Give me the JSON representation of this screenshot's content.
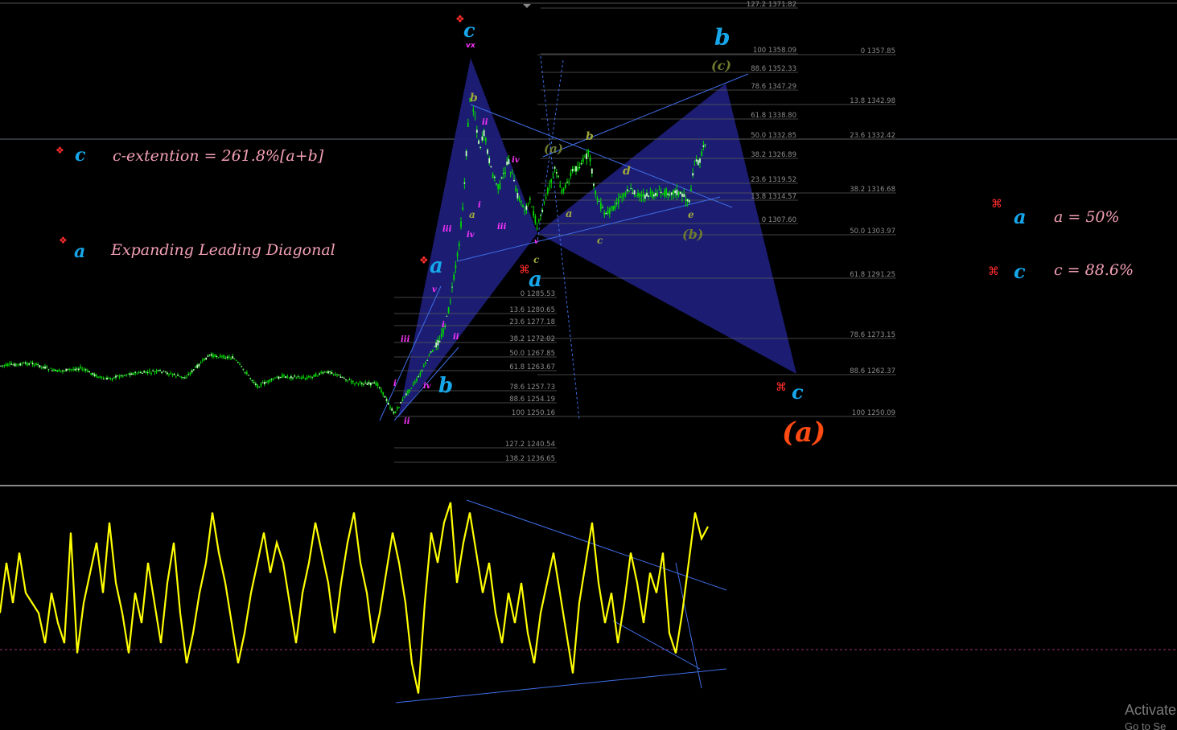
{
  "chart_data": [
    {
      "type": "line",
      "panel": "price",
      "description_from_image": "candlestick price chart with Fibonacci retracements and harmonic pattern",
      "fib_set_right": [
        {
          "label": "0 1357.85"
        },
        {
          "label": "13.8 1342.98"
        },
        {
          "label": "23.6 1332.42"
        },
        {
          "label": "38.2 1316.68"
        },
        {
          "label": "50.0 1303.97"
        },
        {
          "label": "61.8 1291.25"
        },
        {
          "label": "78.6 1273.15"
        },
        {
          "label": "88.6 1262.37"
        },
        {
          "label": "100 1250.09"
        }
      ],
      "fib_set_mid": [
        {
          "label": "127.2 1371.82"
        },
        {
          "label": "100 1358.09"
        },
        {
          "label": "88.6 1352.33"
        },
        {
          "label": "78.6 1347.29"
        },
        {
          "label": "61.8 1338.80"
        },
        {
          "label": "50.0 1332.85"
        },
        {
          "label": "38.2 1326.89"
        },
        {
          "label": "23.6 1319.52"
        },
        {
          "label": "13.8 1314.57"
        },
        {
          "label": "0 1307.60"
        }
      ],
      "fib_set_left": [
        {
          "label": "0 1285.53"
        },
        {
          "label": "13.6 1280.65"
        },
        {
          "label": "23.6 1277.18"
        },
        {
          "label": "38.2 1272.02"
        },
        {
          "label": "50.0 1267.85"
        },
        {
          "label": "61.8 1263.67"
        },
        {
          "label": "78.6 1257.73"
        },
        {
          "label": "88.6 1254.19"
        },
        {
          "label": "100 1250.16"
        },
        {
          "label": "127.2 1240.54"
        },
        {
          "label": "138.2 1236.65"
        }
      ]
    },
    {
      "type": "line",
      "panel": "oscillator",
      "series": [
        {
          "values": [
            0.45,
            0.7,
            0.5,
            0.75,
            0.55,
            0.5,
            0.45,
            0.3,
            0.55,
            0.4,
            0.3,
            0.85,
            0.25,
            0.5,
            0.65,
            0.8,
            0.55,
            0.9,
            0.6,
            0.45,
            0.25,
            0.55,
            0.4,
            0.7,
            0.5,
            0.3,
            0.6,
            0.8,
            0.45,
            0.2,
            0.35,
            0.55,
            0.7,
            0.95,
            0.75,
            0.6,
            0.4,
            0.2,
            0.35,
            0.55,
            0.7,
            0.85,
            0.65,
            0.8,
            0.7,
            0.5,
            0.3,
            0.55,
            0.7,
            0.9,
            0.75,
            0.6,
            0.35,
            0.6,
            0.8,
            0.95,
            0.7,
            0.55,
            0.3,
            0.45,
            0.65,
            0.85,
            0.7,
            0.5,
            0.2,
            0.05,
            0.5,
            0.85,
            0.7,
            0.9,
            1.0,
            0.6,
            0.8,
            0.95,
            0.75,
            0.55,
            0.7,
            0.45,
            0.3,
            0.55,
            0.4,
            0.6,
            0.35,
            0.2,
            0.45,
            0.6,
            0.75,
            0.55,
            0.35,
            0.15,
            0.5,
            0.7,
            0.9,
            0.6,
            0.4,
            0.55,
            0.3,
            0.5,
            0.75,
            0.6,
            0.4,
            0.65,
            0.55,
            0.75,
            0.35,
            0.25,
            0.45,
            0.7,
            0.95,
            0.82,
            0.88
          ]
        }
      ]
    }
  ],
  "labels": {
    "c_top": "c",
    "c_top_sub": "vx",
    "b_right": "b",
    "c_paren": "(c)",
    "b_paren": "(b)",
    "a_paren_upper": "(a)",
    "a_paren_big": "(a)",
    "a_mid": "a",
    "a_left": "a",
    "b_low": "b",
    "c_right": "c",
    "diamond": "❖",
    "cmd": "⌘"
  },
  "notes": {
    "c_ext_label": "c",
    "c_ext_text": "c-extention = 261.8%[a+b]",
    "diag_label": "a",
    "diag_text": "Expanding Leading Diagonal",
    "a_ratio_label": "a",
    "a_ratio_text": "a = 50%",
    "c_ratio_label": "c",
    "c_ratio_text": "c = 88.6%"
  },
  "subwave_labels": {
    "b1": "b",
    "ii1": "ii",
    "iv1": "iv",
    "i1": "i",
    "a1": "a",
    "iii1": "iii",
    "iii2": "iii",
    "iv2": "iv",
    "v1": "v",
    "c1": "c",
    "a2": "a",
    "b2": "b",
    "d1": "d",
    "e1": "e",
    "c2": "c",
    "v2": "v",
    "iii3": "iii",
    "i2": "i",
    "ii2": "ii",
    "i3": "i",
    "iv3": "iv",
    "ii3": "ii"
  },
  "watermark": {
    "line1": "Activate",
    "line2": "Go to Se"
  },
  "colors": {
    "background": "#000000",
    "candles": "#00d800",
    "oscillator": "#ffff00",
    "trendline": "#3f6ee8",
    "pattern_fill": "#1d1f78",
    "wave_blue": "#16a7ea",
    "wave_magenta": "#ff33ff",
    "wave_olive": "#a0a83a",
    "wave_orange": "#ff4a12",
    "note_pink": "#f3a0b4",
    "marker_red": "#ff2d2d"
  }
}
